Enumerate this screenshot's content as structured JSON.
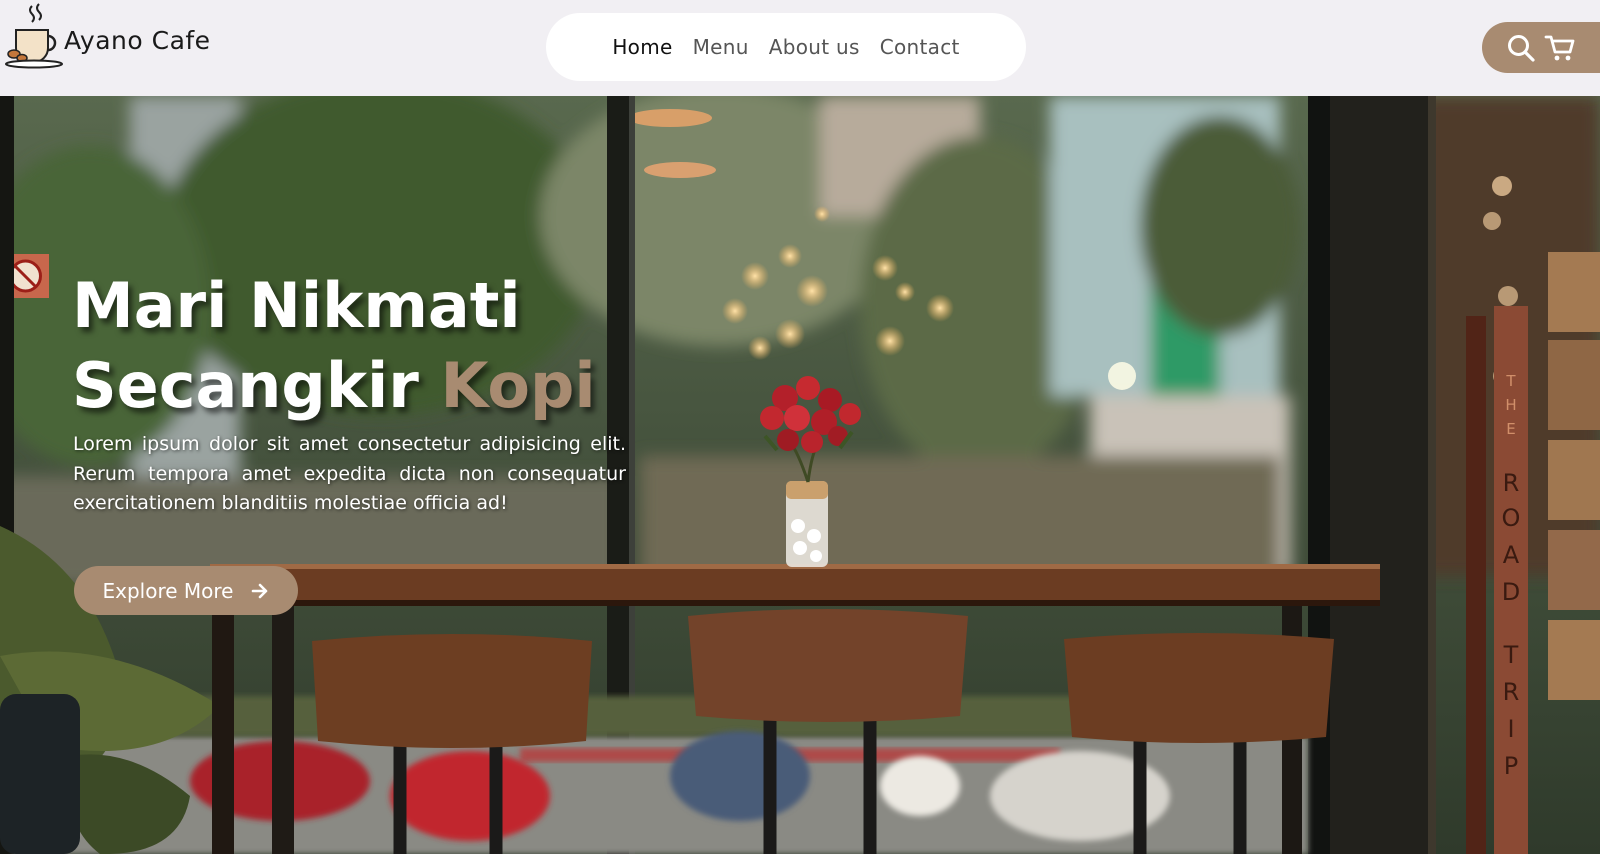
{
  "brand": {
    "name": "Ayano Cafe",
    "logo_icon": "coffee-cup-icon"
  },
  "nav": {
    "items": [
      {
        "label": "Home",
        "active": true
      },
      {
        "label": "Menu",
        "active": false
      },
      {
        "label": "About us",
        "active": false
      },
      {
        "label": "Contact",
        "active": false
      }
    ]
  },
  "header_icons": {
    "search": "search-icon",
    "cart": "cart-icon",
    "background": "#a88b71"
  },
  "hero": {
    "title_line1": "Mari Nikmati",
    "title_line2_main": "Secangkir",
    "title_line2_accent": "Kopi",
    "description": "Lorem ipsum dolor sit amet consectetur adipisicing elit. Rerum tempora amet expedita dicta non consequatur exercitationem blanditiis molestiae officia ad!",
    "button_label": "Explore More",
    "button_icon": "arrow-right-icon",
    "sign_text": "THE ROAD TRIP"
  },
  "colors": {
    "accent": "#a88b71",
    "header_bg": "#f1eff3",
    "nav_bg": "#ffffff"
  }
}
